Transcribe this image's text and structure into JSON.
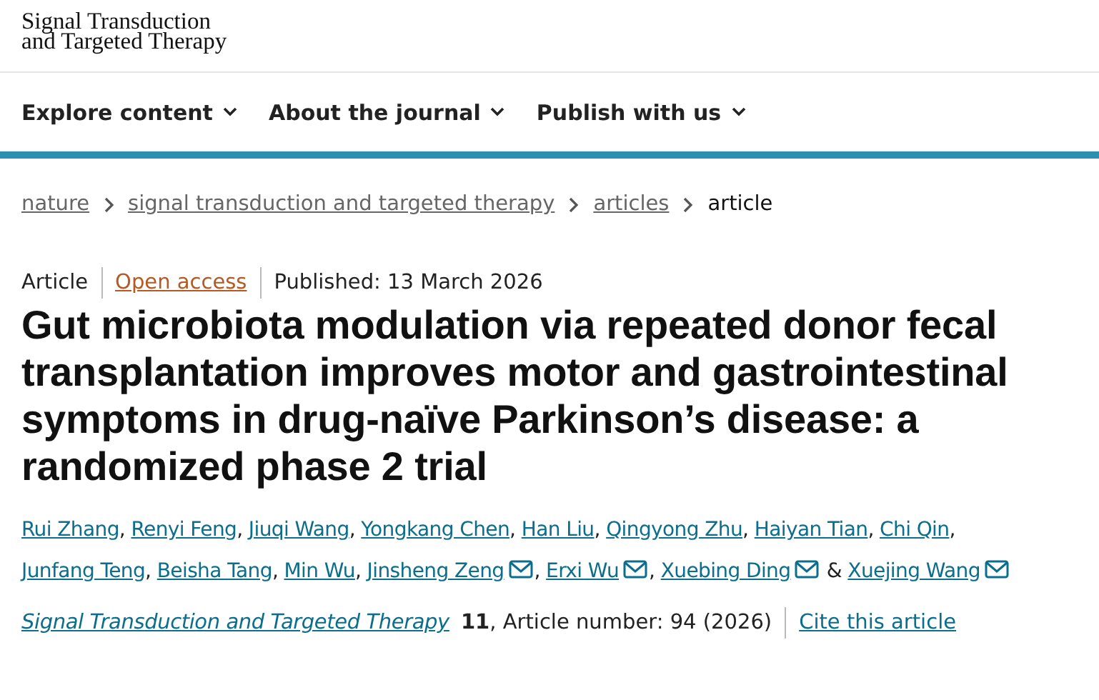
{
  "logo": {
    "lines": [
      "Signal Transduction",
      "and Targeted Therapy"
    ]
  },
  "nav": [
    {
      "label": "Explore content"
    },
    {
      "label": "About the journal"
    },
    {
      "label": "Publish with us"
    }
  ],
  "breadcrumb": [
    {
      "label": "nature",
      "link": true
    },
    {
      "label": "signal transduction and targeted therapy",
      "link": true
    },
    {
      "label": "articles",
      "link": true
    },
    {
      "label": "article",
      "link": false
    }
  ],
  "meta": [
    {
      "kind": "plain",
      "text": "Article"
    },
    {
      "kind": "access",
      "text": "Open access"
    },
    {
      "kind": "plain",
      "text": "Published: 13 March 2026"
    }
  ],
  "title": "Gut microbiota modulation via repeated donor fecal transplantation improves motor and gastrointestinal symptoms in drug-naïve Parkinson’s disease: a randomized phase 2 trial",
  "authors": [
    {
      "name": "Rui Zhang",
      "email": false,
      "separator": ", "
    },
    {
      "name": "Renyi Feng",
      "email": false,
      "separator": ", "
    },
    {
      "name": "Jiuqi Wang",
      "email": false,
      "separator": ", "
    },
    {
      "name": "Yongkang Chen",
      "email": false,
      "separator": ", "
    },
    {
      "name": "Han Liu",
      "email": false,
      "separator": ", "
    },
    {
      "name": "Qingyong Zhu",
      "email": false,
      "separator": ", "
    },
    {
      "name": "Haiyan Tian",
      "email": false,
      "separator": ", "
    },
    {
      "name": "Chi Qin",
      "email": false,
      "separator": ", "
    },
    {
      "name": "Junfang Teng",
      "email": false,
      "separator": ", "
    },
    {
      "name": "Beisha Tang",
      "email": false,
      "separator": ", "
    },
    {
      "name": "Min Wu",
      "email": false,
      "separator": ", "
    },
    {
      "name": "Jinsheng Zeng",
      "email": true,
      "separator": ", "
    },
    {
      "name": "Erxi Wu",
      "email": true,
      "separator": ", "
    },
    {
      "name": "Xuebing Ding",
      "email": true,
      "separator": " & "
    },
    {
      "name": "Xuejing Wang",
      "email": true
    }
  ],
  "citation": {
    "journal": "Signal Transduction and Targeted Therapy",
    "volume": "11",
    "details": ", Article number: 94 (2026)",
    "cite_link": "Cite this article"
  }
}
